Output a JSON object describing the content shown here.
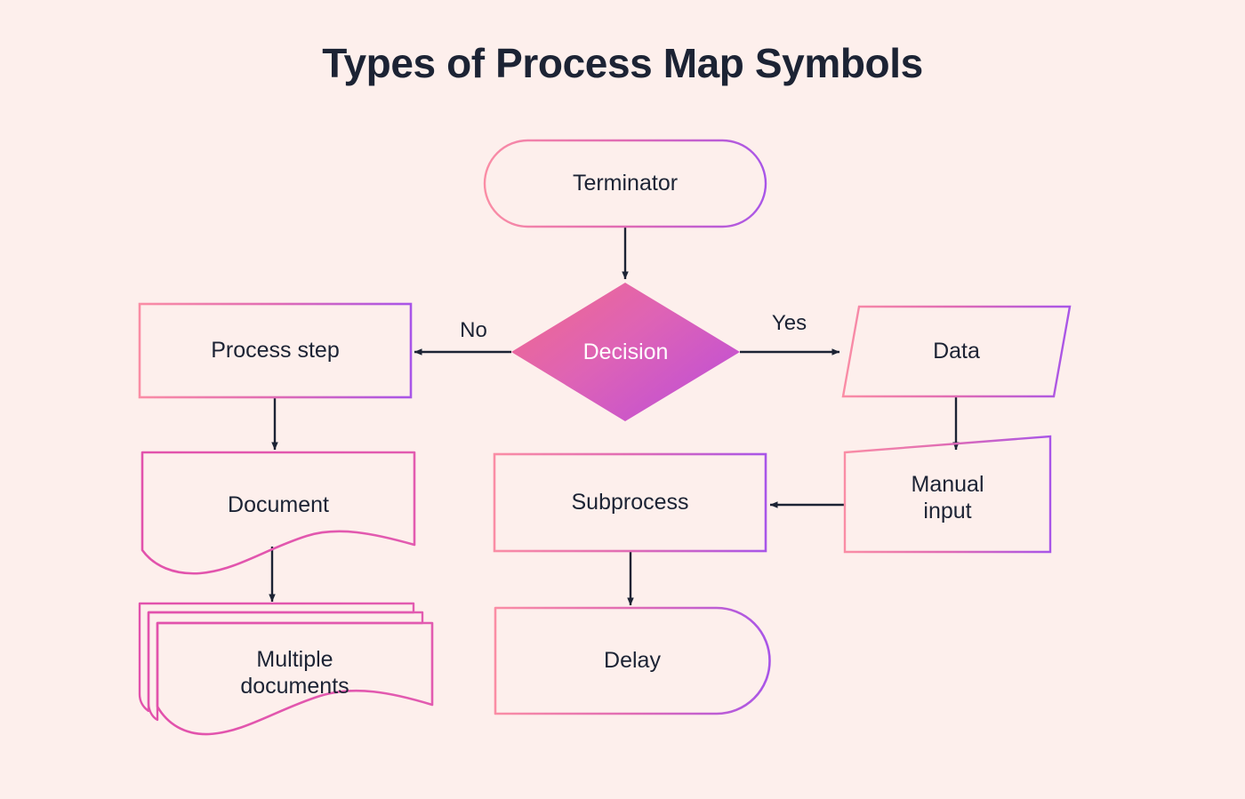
{
  "header": {
    "title": "Types of Process Map Symbols"
  },
  "theme": {
    "background": "#fdefec",
    "text": "#1c2334",
    "gradient_start": "#f9748f",
    "gradient_end": "#a855e8",
    "document_stroke": "#e255ab",
    "arrow": "#1c2334",
    "decision_fill_start": "#f06292",
    "decision_fill_end": "#bf4fd6",
    "decision_text": "#ffffff"
  },
  "diagram": {
    "type": "flowchart",
    "nodes": [
      {
        "id": "terminator",
        "label": "Terminator",
        "shape": "stadium"
      },
      {
        "id": "decision",
        "label": "Decision",
        "shape": "diamond"
      },
      {
        "id": "process-step",
        "label": "Process step",
        "shape": "rectangle"
      },
      {
        "id": "data",
        "label": "Data",
        "shape": "parallelogram"
      },
      {
        "id": "document",
        "label": "Document",
        "shape": "document"
      },
      {
        "id": "subprocess",
        "label": "Subprocess",
        "shape": "rectangle"
      },
      {
        "id": "manual-input",
        "label": "Manual input",
        "shape": "manual-input"
      },
      {
        "id": "multiple-documents",
        "label": "Multiple documents",
        "shape": "multi-document"
      },
      {
        "id": "delay",
        "label": "Delay",
        "shape": "delay"
      }
    ],
    "edges": [
      {
        "from": "terminator",
        "to": "decision",
        "label": ""
      },
      {
        "from": "decision",
        "to": "process-step",
        "label": "No"
      },
      {
        "from": "decision",
        "to": "data",
        "label": "Yes"
      },
      {
        "from": "process-step",
        "to": "document",
        "label": ""
      },
      {
        "from": "document",
        "to": "multiple-documents",
        "label": ""
      },
      {
        "from": "data",
        "to": "manual-input",
        "label": ""
      },
      {
        "from": "manual-input",
        "to": "subprocess",
        "label": ""
      },
      {
        "from": "subprocess",
        "to": "delay",
        "label": ""
      }
    ],
    "labels": {
      "terminator": "Terminator",
      "decision": "Decision",
      "process_step": "Process step",
      "data": "Data",
      "document": "Document",
      "subprocess": "Subprocess",
      "manual_input_line1": "Manual",
      "manual_input_line2": "input",
      "multiple_documents_line1": "Multiple",
      "multiple_documents_line2": "documents",
      "delay": "Delay",
      "edge_no": "No",
      "edge_yes": "Yes"
    }
  }
}
